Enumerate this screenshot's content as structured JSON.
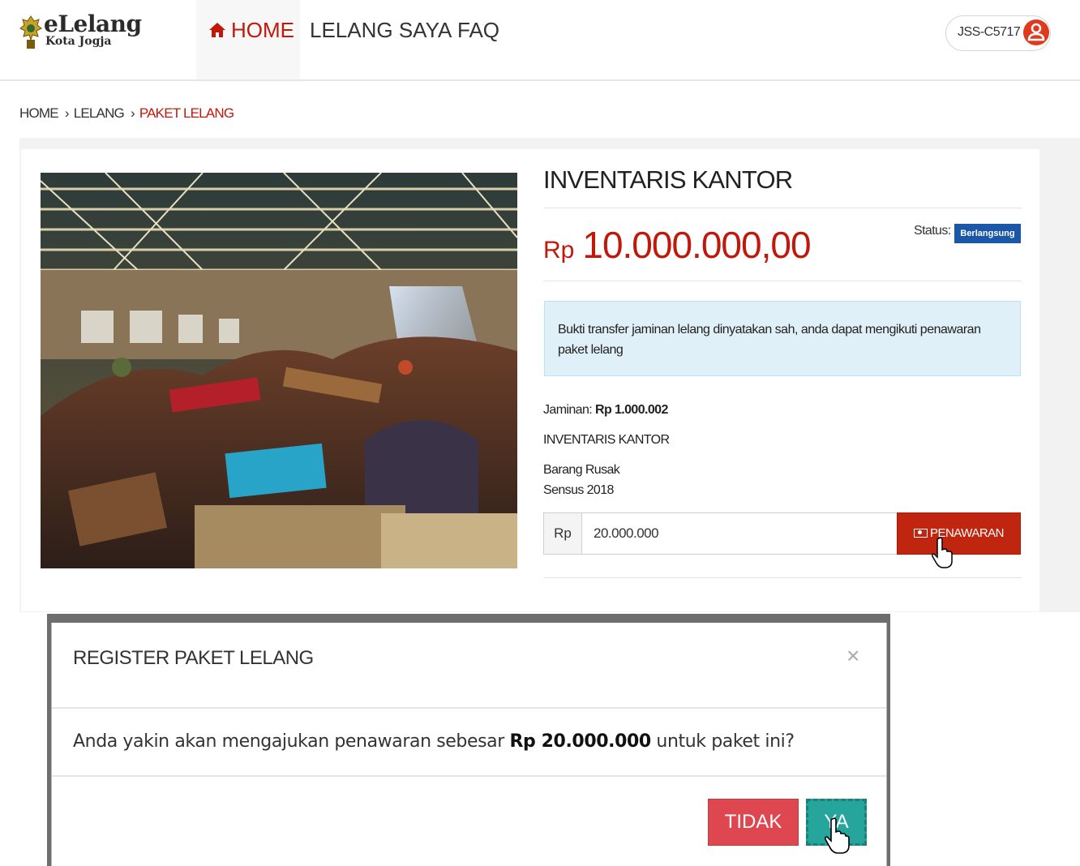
{
  "navbar": {
    "logo_title": "eLelang",
    "logo_subtitle": "Kota Jogja",
    "home_label": "HOME",
    "lelang_saya_label": "LELANG SAYA",
    "faq_label": "FAQ",
    "user_code": "JSS-C5717",
    "accent_color": "#c0180b"
  },
  "breadcrumb": {
    "home": "HOME",
    "lelang": "LELANG",
    "current": "PAKET LELANG"
  },
  "product": {
    "title": "INVENTARIS KANTOR",
    "price_currency": "Rp",
    "price_amount": "10.000.000,00",
    "status_label": "Status:",
    "status_badge": "Berlangsung",
    "alert_text": "Bukti transfer jaminan lelang dinyatakan sah, anda dapat mengikuti penawaran paket lelang",
    "jaminan_label": "Jaminan:",
    "jaminan_value": "Rp 1.000.002",
    "name": "INVENTARIS KANTOR",
    "condition": "Barang Rusak",
    "census": "Sensus 2018"
  },
  "bid": {
    "currency_addon": "Rp",
    "input_value": "20.000.000",
    "button_label": "PENAWARAN"
  },
  "modal": {
    "title": "REGISTER PAKET LELANG",
    "close_symbol": "×",
    "body_prefix": "Anda yakin akan mengajukan penawaran sebesar ",
    "body_amount": "Rp 20.000.000",
    "body_suffix": " untuk paket ini?",
    "btn_no": "TIDAK",
    "btn_yes": "YA"
  }
}
